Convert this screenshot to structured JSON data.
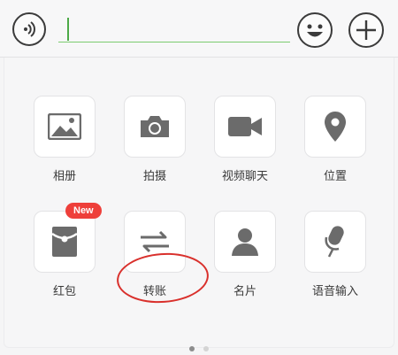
{
  "input_bar": {
    "voice_icon": "voice-icon",
    "emoji_icon": "emoji-icon",
    "plus_icon": "plus-icon",
    "text_value": ""
  },
  "grid": {
    "items": [
      {
        "label": "相册",
        "icon": "photo-icon"
      },
      {
        "label": "拍摄",
        "icon": "camera-icon"
      },
      {
        "label": "视频聊天",
        "icon": "video-icon"
      },
      {
        "label": "位置",
        "icon": "location-icon"
      },
      {
        "label": "红包",
        "icon": "red-packet-icon",
        "badge": "New"
      },
      {
        "label": "转账",
        "icon": "transfer-icon"
      },
      {
        "label": "名片",
        "icon": "contact-card-icon"
      },
      {
        "label": "语音输入",
        "icon": "microphone-icon"
      }
    ]
  },
  "pager": {
    "pages": 2,
    "active": 1
  },
  "colors": {
    "accent_green": "#7ccc70",
    "badge_red": "#ee3f3a",
    "annotation_red": "#d9302c",
    "icon_gray": "#6b6b6b"
  }
}
